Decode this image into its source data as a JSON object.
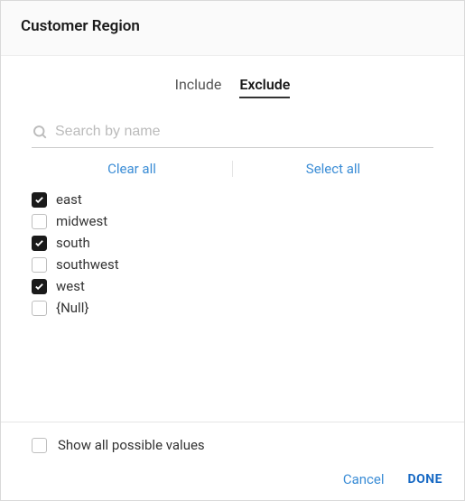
{
  "header": {
    "title": "Customer Region"
  },
  "tabs": {
    "include": "Include",
    "exclude": "Exclude",
    "active": "exclude"
  },
  "search": {
    "placeholder": "Search by name",
    "value": ""
  },
  "actions": {
    "clear_all": "Clear all",
    "select_all": "Select all"
  },
  "values": [
    {
      "label": "east",
      "checked": true
    },
    {
      "label": "midwest",
      "checked": false
    },
    {
      "label": "south",
      "checked": true
    },
    {
      "label": "southwest",
      "checked": false
    },
    {
      "label": "west",
      "checked": true
    },
    {
      "label": "{Null}",
      "checked": false
    }
  ],
  "footer": {
    "show_all_label": "Show all possible values",
    "show_all_checked": false,
    "cancel": "Cancel",
    "done": "DONE"
  }
}
